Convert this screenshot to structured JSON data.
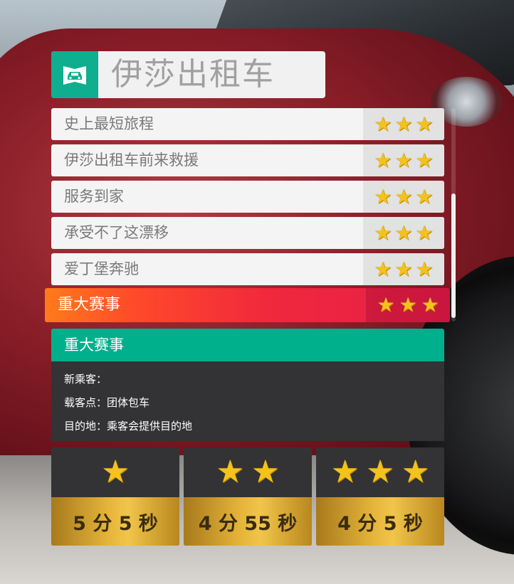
{
  "header": {
    "title": "伊莎出租车",
    "icon": "taxi-car-icon",
    "accent": "#0fae8e"
  },
  "events": [
    {
      "label": "史上最短旅程",
      "stars": 3
    },
    {
      "label": "伊莎出租车前来救援",
      "stars": 3
    },
    {
      "label": "服务到家",
      "stars": 3
    },
    {
      "label": "承受不了这漂移",
      "stars": 3
    },
    {
      "label": "爱丁堡奔驰",
      "stars": 3
    }
  ],
  "selected": {
    "label": "重大赛事",
    "stars": 3
  },
  "detail": {
    "title": "重大赛事",
    "lines": [
      {
        "key": "新乘客：",
        "value": ""
      },
      {
        "key": "载客点：",
        "value": "团体包车"
      },
      {
        "key": "目的地：",
        "value": "乘客会提供目的地"
      }
    ]
  },
  "rewards": [
    {
      "stars": 1,
      "time": "5 分 5 秒"
    },
    {
      "stars": 2,
      "time": "4 分 55 秒"
    },
    {
      "stars": 3,
      "time": "4 分 5 秒"
    }
  ],
  "star_glyph": "★",
  "colors": {
    "selected_start": "#ff7a1a",
    "selected_end": "#e61e4a",
    "detail_header": "#00b08c",
    "gold": "#e6b53a"
  }
}
